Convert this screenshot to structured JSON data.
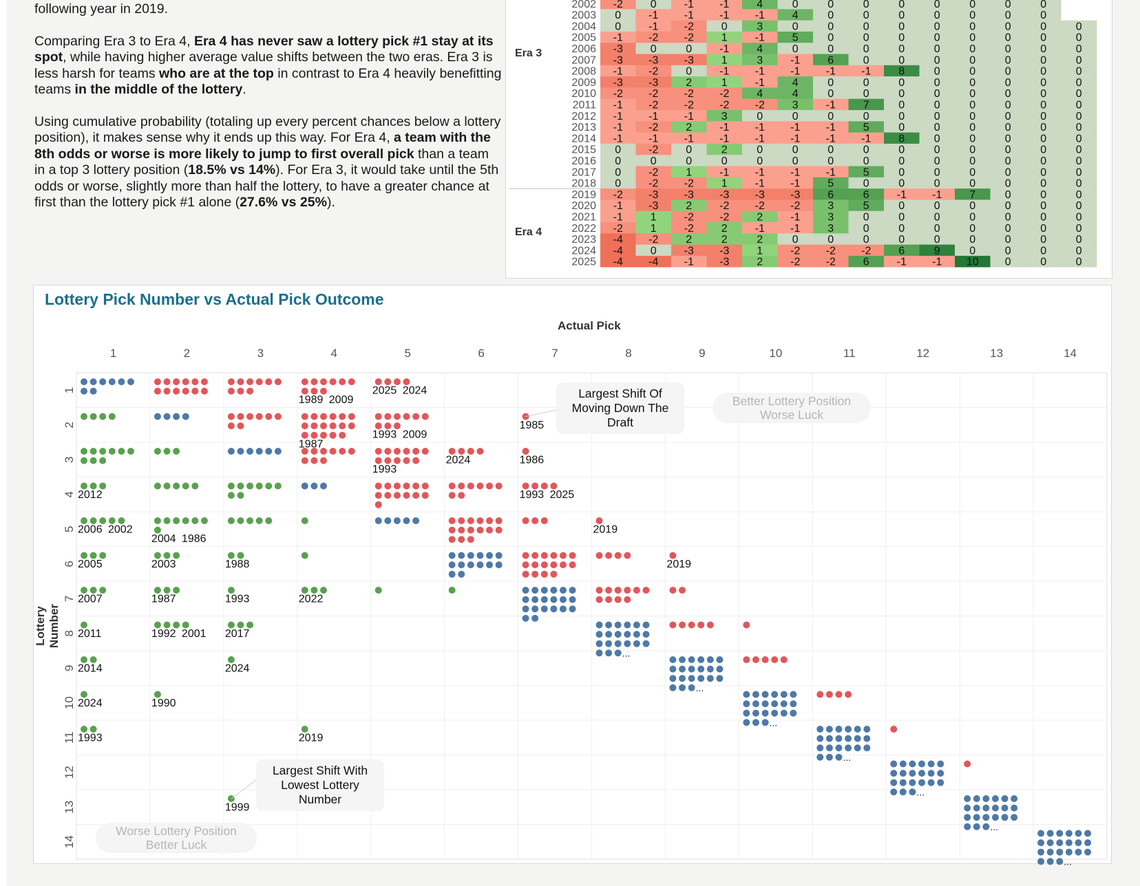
{
  "story": {
    "p1": "following year in 2019.",
    "p2": [
      {
        "t": "Comparing Era 3 to Era 4, ",
        "b": false
      },
      {
        "t": "Era 4 has never saw a lottery pick #1 stay at its spot",
        "b": true
      },
      {
        "t": ", while having higher average value shifts between the two eras. Era 3 is less harsh for teams ",
        "b": false
      },
      {
        "t": "who are at the top",
        "b": true
      },
      {
        "t": " in contrast to Era 4 heavily benefitting teams ",
        "b": false
      },
      {
        "t": "in the middle of the lottery",
        "b": true
      },
      {
        "t": ".",
        "b": false
      }
    ],
    "p3": [
      {
        "t": "Using cumulative probability (totaling up every percent chances below a lottery position), it makes sense why it ends up this way. For Era 4, ",
        "b": false
      },
      {
        "t": "a team with the 8th odds or worse is more likely to jump to first overall pick",
        "b": true
      },
      {
        "t": " than a team in a top 3 lottery position (",
        "b": false
      },
      {
        "t": "18.5% vs 14%",
        "b": true
      },
      {
        "t": "). For Era 3, it would take until the 5th odds or worse, slightly more than half the lottery, to have a greater chance at first than the lottery pick #1 alone (",
        "b": false
      },
      {
        "t": "27.6% vs 25%",
        "b": true
      },
      {
        "t": ").",
        "b": false
      }
    ]
  },
  "heatmap": {
    "eras": [
      {
        "label": "Era 3",
        "years": [
          "2002",
          "2003",
          "2004",
          "2005",
          "2006",
          "2007",
          "2008",
          "2009",
          "2010",
          "2011",
          "2012",
          "2013",
          "2014",
          "2015",
          "2016",
          "2017",
          "2018"
        ]
      },
      {
        "label": "Era 4",
        "years": [
          "2019",
          "2020",
          "2021",
          "2022",
          "2023",
          "2024",
          "2025"
        ]
      }
    ],
    "rows": [
      [
        -2,
        0,
        -1,
        -1,
        4,
        0,
        0,
        0,
        0,
        0,
        0,
        0,
        0,
        null
      ],
      [
        0,
        -1,
        -1,
        -1,
        -1,
        4,
        0,
        0,
        0,
        0,
        0,
        0,
        0,
        null
      ],
      [
        0,
        -1,
        -2,
        0,
        3,
        0,
        0,
        0,
        0,
        0,
        0,
        0,
        0,
        0
      ],
      [
        -1,
        -2,
        -2,
        1,
        -1,
        5,
        0,
        0,
        0,
        0,
        0,
        0,
        0,
        0
      ],
      [
        -3,
        0,
        0,
        -1,
        4,
        0,
        0,
        0,
        0,
        0,
        0,
        0,
        0,
        0
      ],
      [
        -3,
        -3,
        -3,
        1,
        3,
        -1,
        6,
        0,
        0,
        0,
        0,
        0,
        0,
        0
      ],
      [
        -1,
        -2,
        0,
        -1,
        -1,
        -1,
        -1,
        -1,
        8,
        0,
        0,
        0,
        0,
        0
      ],
      [
        -3,
        -3,
        2,
        1,
        -1,
        4,
        0,
        0,
        0,
        0,
        0,
        0,
        0,
        0
      ],
      [
        -2,
        -2,
        -2,
        -2,
        4,
        4,
        0,
        0,
        0,
        0,
        0,
        0,
        0,
        0
      ],
      [
        -1,
        -2,
        -2,
        -2,
        -2,
        3,
        -1,
        7,
        0,
        0,
        0,
        0,
        0,
        0
      ],
      [
        -1,
        -1,
        -1,
        3,
        0,
        0,
        0,
        0,
        0,
        0,
        0,
        0,
        0,
        0
      ],
      [
        -1,
        -2,
        2,
        -1,
        -1,
        -1,
        -1,
        5,
        0,
        0,
        0,
        0,
        0,
        0
      ],
      [
        -1,
        -1,
        -1,
        -1,
        -1,
        -1,
        -1,
        -1,
        8,
        0,
        0,
        0,
        0,
        0
      ],
      [
        0,
        -2,
        0,
        2,
        0,
        0,
        0,
        0,
        0,
        0,
        0,
        0,
        0,
        0
      ],
      [
        0,
        0,
        0,
        0,
        0,
        0,
        0,
        0,
        0,
        0,
        0,
        0,
        0,
        0
      ],
      [
        0,
        -2,
        1,
        -1,
        -1,
        -1,
        -1,
        5,
        0,
        0,
        0,
        0,
        0,
        0
      ],
      [
        0,
        -2,
        -2,
        1,
        -1,
        -1,
        5,
        0,
        0,
        0,
        0,
        0,
        0,
        0
      ],
      [
        -2,
        -3,
        -3,
        -3,
        -3,
        -3,
        6,
        6,
        -1,
        -1,
        7,
        0,
        0,
        0
      ],
      [
        -1,
        -3,
        2,
        -2,
        -2,
        -2,
        3,
        5,
        0,
        0,
        0,
        0,
        0,
        0
      ],
      [
        -1,
        1,
        -2,
        -2,
        2,
        -1,
        3,
        0,
        0,
        0,
        0,
        0,
        0,
        0
      ],
      [
        -2,
        1,
        -2,
        2,
        -1,
        -1,
        3,
        0,
        0,
        0,
        0,
        0,
        0,
        0
      ],
      [
        -4,
        -2,
        2,
        2,
        2,
        0,
        0,
        0,
        0,
        0,
        0,
        0,
        0,
        0
      ],
      [
        -4,
        0,
        -3,
        -3,
        1,
        -2,
        -2,
        -2,
        6,
        9,
        0,
        0,
        0,
        0
      ],
      [
        -4,
        -4,
        -1,
        -3,
        2,
        -2,
        -2,
        6,
        -1,
        -1,
        10,
        0,
        0,
        0
      ]
    ]
  },
  "chart_data": {
    "type": "scatter",
    "title": "Lottery Pick Number vs Actual Pick Outcome",
    "xlabel": "Actual Pick",
    "ylabel": "Lottery Number",
    "x_ticks": [
      "1",
      "2",
      "3",
      "4",
      "5",
      "6",
      "7",
      "8",
      "9",
      "10",
      "11",
      "12",
      "13",
      "14"
    ],
    "y_ticks": [
      "1",
      "2",
      "3",
      "4",
      "5",
      "6",
      "7",
      "8",
      "9",
      "10",
      "11",
      "12",
      "13",
      "14"
    ],
    "legend_colors": {
      "same": "#4e79a7",
      "lower": "#e15759",
      "higher": "#59a14f"
    },
    "cells": [
      {
        "lottery": 1,
        "pick": 1,
        "count": 8,
        "color": "same"
      },
      {
        "lottery": 1,
        "pick": 2,
        "count": 12,
        "color": "lower"
      },
      {
        "lottery": 1,
        "pick": 3,
        "count": 9,
        "color": "lower"
      },
      {
        "lottery": 1,
        "pick": 4,
        "count": 9,
        "color": "lower",
        "labels": [
          "1989",
          "2009"
        ]
      },
      {
        "lottery": 1,
        "pick": 5,
        "count": 4,
        "color": "lower",
        "labels": [
          "2025",
          "2024"
        ]
      },
      {
        "lottery": 2,
        "pick": 1,
        "count": 4,
        "color": "higher"
      },
      {
        "lottery": 2,
        "pick": 2,
        "count": 4,
        "color": "same"
      },
      {
        "lottery": 2,
        "pick": 3,
        "count": 8,
        "color": "lower"
      },
      {
        "lottery": 2,
        "pick": 4,
        "count": 17,
        "color": "lower",
        "labels": [
          "1987"
        ]
      },
      {
        "lottery": 2,
        "pick": 5,
        "count": 9,
        "color": "lower",
        "labels": [
          "1993",
          "2009"
        ]
      },
      {
        "lottery": 2,
        "pick": 7,
        "count": 1,
        "color": "lower",
        "labels": [
          "1985"
        ]
      },
      {
        "lottery": 3,
        "pick": 1,
        "count": 9,
        "color": "higher"
      },
      {
        "lottery": 3,
        "pick": 2,
        "count": 3,
        "color": "higher"
      },
      {
        "lottery": 3,
        "pick": 3,
        "count": 6,
        "color": "same"
      },
      {
        "lottery": 3,
        "pick": 4,
        "count": 9,
        "color": "lower"
      },
      {
        "lottery": 3,
        "pick": 5,
        "count": 11,
        "color": "lower",
        "labels": [
          "1993"
        ]
      },
      {
        "lottery": 3,
        "pick": 6,
        "count": 4,
        "color": "lower",
        "labels": [
          "2024"
        ]
      },
      {
        "lottery": 3,
        "pick": 7,
        "count": 1,
        "color": "lower",
        "labels": [
          "1986"
        ]
      },
      {
        "lottery": 4,
        "pick": 1,
        "count": 3,
        "color": "higher",
        "labels": [
          "2012"
        ]
      },
      {
        "lottery": 4,
        "pick": 2,
        "count": 5,
        "color": "higher"
      },
      {
        "lottery": 4,
        "pick": 3,
        "count": 8,
        "color": "higher"
      },
      {
        "lottery": 4,
        "pick": 4,
        "count": 3,
        "color": "same"
      },
      {
        "lottery": 4,
        "pick": 5,
        "count": 13,
        "color": "lower"
      },
      {
        "lottery": 4,
        "pick": 6,
        "count": 8,
        "color": "lower"
      },
      {
        "lottery": 4,
        "pick": 7,
        "count": 4,
        "color": "lower",
        "labels": [
          "1993",
          "2025"
        ]
      },
      {
        "lottery": 5,
        "pick": 1,
        "count": 5,
        "color": "higher",
        "labels": [
          "2006",
          "2002"
        ]
      },
      {
        "lottery": 5,
        "pick": 2,
        "count": 7,
        "color": "higher",
        "labels": [
          "2004",
          "1986"
        ]
      },
      {
        "lottery": 5,
        "pick": 3,
        "count": 5,
        "color": "higher"
      },
      {
        "lottery": 5,
        "pick": 4,
        "count": 1,
        "color": "higher"
      },
      {
        "lottery": 5,
        "pick": 5,
        "count": 5,
        "color": "same"
      },
      {
        "lottery": 5,
        "pick": 6,
        "count": 15,
        "color": "lower"
      },
      {
        "lottery": 5,
        "pick": 7,
        "count": 3,
        "color": "lower"
      },
      {
        "lottery": 5,
        "pick": 8,
        "count": 1,
        "color": "lower",
        "labels": [
          "2019"
        ]
      },
      {
        "lottery": 6,
        "pick": 1,
        "count": 3,
        "color": "higher",
        "labels": [
          "2005"
        ]
      },
      {
        "lottery": 6,
        "pick": 2,
        "count": 3,
        "color": "higher",
        "labels": [
          "2003"
        ]
      },
      {
        "lottery": 6,
        "pick": 3,
        "count": 2,
        "color": "higher",
        "labels": [
          "1988"
        ]
      },
      {
        "lottery": 6,
        "pick": 4,
        "count": 1,
        "color": "higher"
      },
      {
        "lottery": 6,
        "pick": 6,
        "count": 14,
        "color": "same"
      },
      {
        "lottery": 6,
        "pick": 7,
        "count": 16,
        "color": "lower"
      },
      {
        "lottery": 6,
        "pick": 8,
        "count": 4,
        "color": "lower"
      },
      {
        "lottery": 6,
        "pick": 9,
        "count": 1,
        "color": "lower",
        "labels": [
          "2019"
        ]
      },
      {
        "lottery": 7,
        "pick": 1,
        "count": 3,
        "color": "higher",
        "labels": [
          "2007"
        ]
      },
      {
        "lottery": 7,
        "pick": 2,
        "count": 3,
        "color": "higher",
        "labels": [
          "1987"
        ]
      },
      {
        "lottery": 7,
        "pick": 3,
        "count": 1,
        "color": "higher",
        "labels": [
          "1993"
        ]
      },
      {
        "lottery": 7,
        "pick": 4,
        "count": 3,
        "color": "higher",
        "labels": [
          "2022"
        ]
      },
      {
        "lottery": 7,
        "pick": 5,
        "count": 1,
        "color": "higher"
      },
      {
        "lottery": 7,
        "pick": 6,
        "count": 1,
        "color": "higher"
      },
      {
        "lottery": 7,
        "pick": 7,
        "count": 20,
        "color": "same"
      },
      {
        "lottery": 7,
        "pick": 8,
        "count": 10,
        "color": "lower"
      },
      {
        "lottery": 7,
        "pick": 9,
        "count": 2,
        "color": "lower"
      },
      {
        "lottery": 8,
        "pick": 1,
        "count": 1,
        "color": "higher",
        "labels": [
          "2011"
        ]
      },
      {
        "lottery": 8,
        "pick": 2,
        "count": 4,
        "color": "higher",
        "labels": [
          "1992",
          "2001"
        ]
      },
      {
        "lottery": 8,
        "pick": 3,
        "count": 3,
        "color": "higher",
        "labels": [
          "2017"
        ]
      },
      {
        "lottery": 8,
        "pick": 8,
        "count": 21,
        "color": "same",
        "more": true
      },
      {
        "lottery": 8,
        "pick": 9,
        "count": 5,
        "color": "lower"
      },
      {
        "lottery": 8,
        "pick": 10,
        "count": 1,
        "color": "lower"
      },
      {
        "lottery": 9,
        "pick": 1,
        "count": 2,
        "color": "higher",
        "labels": [
          "2014"
        ]
      },
      {
        "lottery": 9,
        "pick": 3,
        "count": 1,
        "color": "higher",
        "labels": [
          "2024"
        ]
      },
      {
        "lottery": 9,
        "pick": 9,
        "count": 21,
        "color": "same",
        "more": true
      },
      {
        "lottery": 9,
        "pick": 10,
        "count": 5,
        "color": "lower"
      },
      {
        "lottery": 10,
        "pick": 1,
        "count": 1,
        "color": "higher",
        "labels": [
          "2024"
        ]
      },
      {
        "lottery": 10,
        "pick": 2,
        "count": 1,
        "color": "higher",
        "labels": [
          "1990"
        ]
      },
      {
        "lottery": 10,
        "pick": 10,
        "count": 21,
        "color": "same",
        "more": true
      },
      {
        "lottery": 10,
        "pick": 11,
        "count": 4,
        "color": "lower"
      },
      {
        "lottery": 11,
        "pick": 1,
        "count": 2,
        "color": "higher",
        "labels": [
          "1993"
        ]
      },
      {
        "lottery": 11,
        "pick": 4,
        "count": 1,
        "color": "higher",
        "labels": [
          "2019"
        ]
      },
      {
        "lottery": 11,
        "pick": 11,
        "count": 21,
        "color": "same",
        "more": true
      },
      {
        "lottery": 11,
        "pick": 12,
        "count": 1,
        "color": "lower"
      },
      {
        "lottery": 12,
        "pick": 12,
        "count": 21,
        "color": "same",
        "more": true
      },
      {
        "lottery": 12,
        "pick": 13,
        "count": 1,
        "color": "lower"
      },
      {
        "lottery": 13,
        "pick": 3,
        "count": 1,
        "color": "higher",
        "labels": [
          "1999"
        ]
      },
      {
        "lottery": 13,
        "pick": 13,
        "count": 21,
        "color": "same",
        "more": true
      },
      {
        "lottery": 14,
        "pick": 14,
        "count": 21,
        "color": "same",
        "more": true
      }
    ],
    "annotations": [
      {
        "text": "Largest Shift Of Moving Down The Draft",
        "target_lottery": 2,
        "target_pick": 7
      },
      {
        "text": "Largest Shift With Lowest Lottery Number",
        "target_lottery": 13,
        "target_pick": 3
      }
    ],
    "region_labels": [
      "Better Lottery Position Worse Luck",
      "Worse Lottery Position Better Luck"
    ],
    "more_marker": "..."
  }
}
